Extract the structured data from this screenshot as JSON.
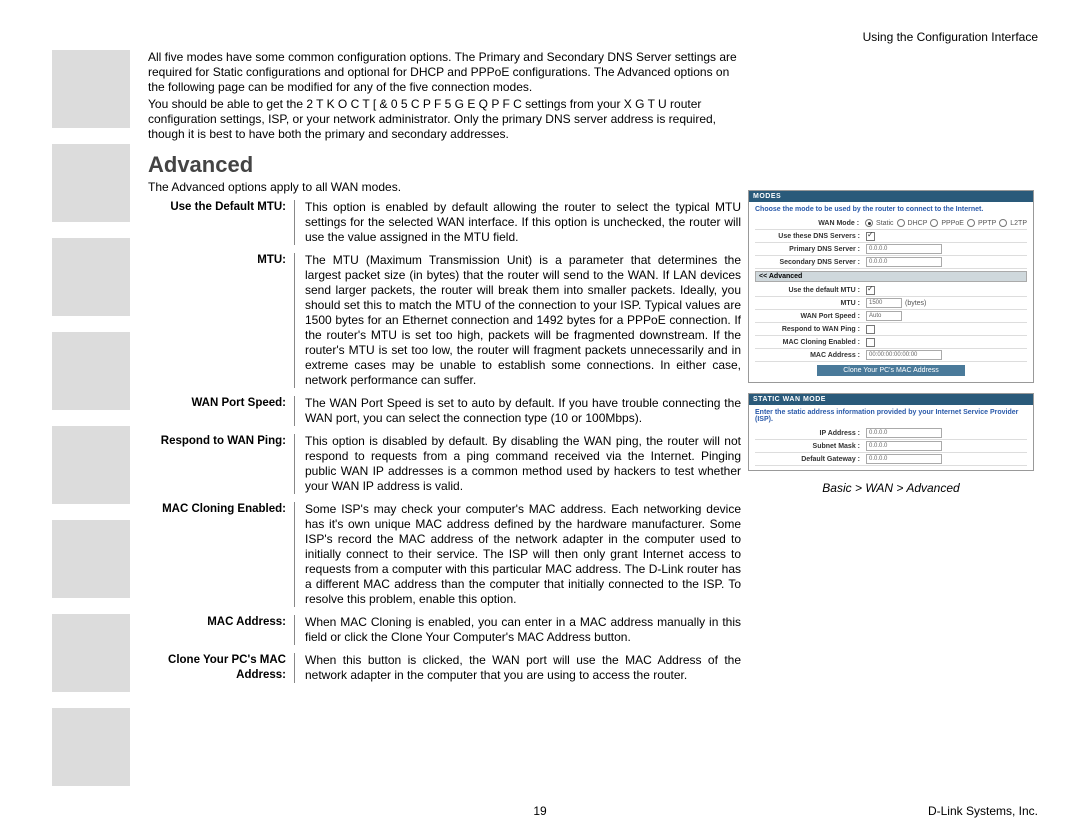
{
  "header": {
    "right": "Using the Configuration Interface"
  },
  "intro": {
    "p1": "All five modes have some common configuration options. The Primary and Secondary DNS Server settings are required for Static configurations and optional for DHCP and PPPoE configurations. The Advanced options on the following page can be modified for any of the five connection modes.",
    "p2": "You should be able to get the 2 T K O C T [  & 0 5  C P F  5 G E Q P F C settings from your X G T U router configuration settings, ISP, or your network administrator. Only the primary DNS server address is required, though it is best to have both the primary and secondary addresses."
  },
  "section": {
    "title": "Advanced",
    "sub": "The Advanced options apply to all WAN modes."
  },
  "items": [
    {
      "label": "Use the Default MTU:",
      "desc": "This option is enabled by default allowing the router to select the typical MTU settings for the selected WAN interface. If this option is unchecked, the router will use the value assigned in the MTU field."
    },
    {
      "label": "MTU:",
      "desc": "The MTU (Maximum Transmission Unit) is a parameter that determines the largest packet size (in bytes) that the router will send to the WAN. If LAN devices send larger packets, the router will break them into smaller packets. Ideally, you should set this to match the MTU of the connection to your ISP. Typical values are 1500 bytes for an Ethernet connection and 1492 bytes for a PPPoE connection. If the router's MTU is set too high, packets will be fragmented downstream. If the router's MTU is set too low, the router will fragment packets unnecessarily and in extreme cases may be unable to establish some connections. In either case, network performance can suffer."
    },
    {
      "label": "WAN Port Speed:",
      "desc": "The WAN Port Speed is set to auto by default. If you have trouble connecting the WAN port, you can select the connection type (10 or 100Mbps)."
    },
    {
      "label": "Respond to WAN Ping:",
      "desc": "This option is disabled by default. By disabling the WAN ping, the router will not respond to requests from a ping command received via the Internet. Pinging public WAN IP addresses is a common method used by hackers to test whether your WAN IP address is valid."
    },
    {
      "label": "MAC Cloning Enabled:",
      "desc": "Some ISP's may check your computer's MAC address. Each networking device has it's own unique MAC address defined by the hardware manufacturer. Some ISP's record the MAC address of the network adapter in the computer used to initially connect to their service. The ISP will then only grant Internet access to requests from a computer with this particular MAC address. The D-Link router has a different MAC address than the computer that initially connected to the ISP. To resolve this problem, enable this option."
    },
    {
      "label": "MAC Address:",
      "desc": "When MAC Cloning is enabled, you can enter in a MAC address manually in this field or click the Clone Your Computer's MAC Address button."
    },
    {
      "label": "Clone Your PC's MAC Address:",
      "desc": "When this button is clicked, the WAN port will use the MAC Address of the network adapter in the computer that you are using to access the router."
    }
  ],
  "panel": {
    "modes": {
      "header": "MODES",
      "note": "Choose the mode to be used by the router to connect to the Internet.",
      "wan_mode_label": "WAN Mode :",
      "wan_mode_options": [
        "Static",
        "DHCP",
        "PPPoE",
        "PPTP",
        "L2TP"
      ],
      "use_dns_label": "Use these DNS Servers :",
      "primary_dns_label": "Primary DNS Server :",
      "primary_dns_value": "0.0.0.0",
      "secondary_dns_label": "Secondary DNS Server :",
      "secondary_dns_value": "0.0.0.0",
      "advanced_bar": "<< Advanced",
      "use_default_mtu_label": "Use the default MTU :",
      "mtu_label": "MTU :",
      "mtu_value": "1500",
      "mtu_unit": "(bytes)",
      "wan_port_speed_label": "WAN Port Speed :",
      "wan_port_speed_value": "Auto",
      "respond_ping_label": "Respond to WAN Ping :",
      "mac_cloning_label": "MAC Cloning Enabled :",
      "mac_address_label": "MAC Address :",
      "mac_address_value": "00:00:00:00:00:00",
      "clone_btn": "Clone Your PC's MAC Address"
    },
    "static": {
      "header": "STATIC WAN MODE",
      "note": "Enter the static address information provided by your Internet Service Provider (ISP).",
      "ip_label": "IP Address :",
      "ip_value": "0.0.0.0",
      "mask_label": "Subnet Mask :",
      "mask_value": "0.0.0.0",
      "gw_label": "Default Gateway :",
      "gw_value": "0.0.0.0"
    },
    "caption": "Basic > WAN > Advanced"
  },
  "footer": {
    "page": "19",
    "right": "D-Link Systems, Inc."
  }
}
